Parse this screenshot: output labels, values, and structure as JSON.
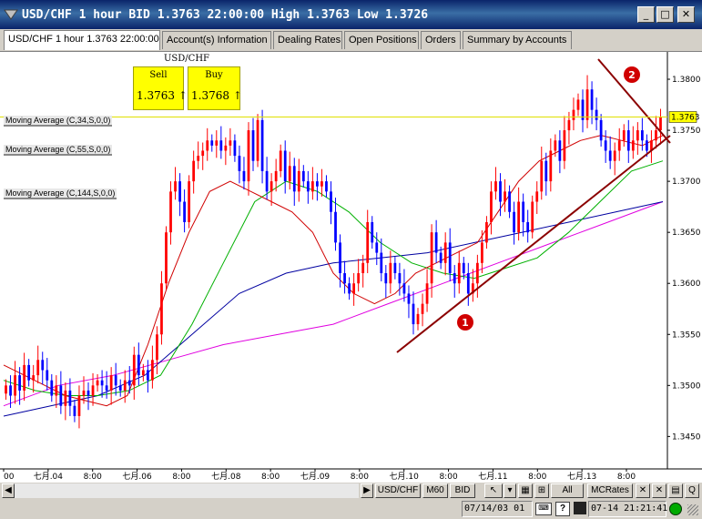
{
  "window": {
    "title": "USD/CHF 1 hour BID 1.3763 22:00:00 High 1.3763 Low 1.3726",
    "controls": [
      "_",
      "□",
      "✕"
    ]
  },
  "tabs": [
    {
      "label": "USD/CHF 1 hour 1.3763 22:00:00",
      "active": true
    },
    {
      "label": "Account(s) Information"
    },
    {
      "label": "Dealing Rates"
    },
    {
      "label": "Open Positions"
    },
    {
      "label": "Orders"
    },
    {
      "label": "Summary by Accounts"
    }
  ],
  "quote": {
    "symbol": "USD/CHF",
    "sell_label": "Sell",
    "buy_label": "Buy",
    "sell_value": "1.3763",
    "buy_value": "1.3768",
    "arrow": "↑"
  },
  "indicators": [
    "Moving Average (C,34,S,0,0)",
    "Moving Average (C,55,S,0,0)",
    "Moving Average (C,144,S,0,0)"
  ],
  "price_axis": {
    "ticks": [
      "1.3800",
      "1.3750",
      "1.3700",
      "1.3650",
      "1.3600",
      "1.3550",
      "1.3500",
      "1.3450"
    ],
    "current": "1.3763"
  },
  "time_axis": {
    "ticks": [
      "00",
      "七月.04",
      "8:00",
      "七月.06",
      "8:00",
      "七月.08",
      "8:00",
      "七月.09",
      "8:00",
      "七月.10",
      "8:00",
      "七月.11",
      "8:00",
      "七月.13",
      "8:00"
    ]
  },
  "annotations": {
    "label1": "❶",
    "label2": "❷"
  },
  "bottom_bar": {
    "play": "▶",
    "symbol": "USD/CHF",
    "period": "M60",
    "price_type": "BID",
    "all": "All",
    "mcrates": "MCRates",
    "q": "Q"
  },
  "status": {
    "left": "07/14/03 01",
    "right": "07-14 21:21:41"
  },
  "colors": {
    "bull_candle": "#ff0000",
    "bear_candle": "#0000ff",
    "ma34": "#d00000",
    "ma55": "#00b000",
    "ma144": "#0000a0",
    "ma_magenta": "#e000e0",
    "trendline": "#8b0000",
    "quote_box": "#ffff00"
  },
  "chart_data": {
    "type": "candlestick",
    "ylim": [
      1.342,
      1.3825
    ],
    "x_range": [
      0,
      145
    ],
    "closes": [
      1.35,
      1.349,
      1.351,
      1.3495,
      1.352,
      1.3505,
      1.351,
      1.3525,
      1.3515,
      1.3505,
      1.349,
      1.35,
      1.348,
      1.3495,
      1.348,
      1.347,
      1.349,
      1.3495,
      1.349,
      1.35,
      1.3505,
      1.35,
      1.3495,
      1.351,
      1.35,
      1.3495,
      1.3505,
      1.35,
      1.353,
      1.351,
      1.3515,
      1.3505,
      1.3525,
      1.355,
      1.36,
      1.365,
      1.369,
      1.37,
      1.368,
      1.366,
      1.37,
      1.372,
      1.3725,
      1.373,
      1.374,
      1.3735,
      1.374,
      1.373,
      1.3735,
      1.374,
      1.3725,
      1.371,
      1.37,
      1.375,
      1.372,
      1.376,
      1.371,
      1.369,
      1.37,
      1.371,
      1.373,
      1.37,
      1.3715,
      1.369,
      1.371,
      1.37,
      1.369,
      1.37,
      1.3695,
      1.37,
      1.369,
      1.367,
      1.364,
      1.361,
      1.36,
      1.359,
      1.36,
      1.361,
      1.362,
      1.366,
      1.364,
      1.363,
      1.361,
      1.36,
      1.362,
      1.361,
      1.36,
      1.359,
      1.358,
      1.356,
      1.357,
      1.358,
      1.36,
      1.365,
      1.363,
      1.362,
      1.364,
      1.361,
      1.36,
      1.362,
      1.361,
      1.359,
      1.36,
      1.362,
      1.364,
      1.366,
      1.369,
      1.37,
      1.368,
      1.369,
      1.367,
      1.365,
      1.368,
      1.366,
      1.365,
      1.368,
      1.369,
      1.372,
      1.37,
      1.373,
      1.374,
      1.372,
      1.375,
      1.376,
      1.377,
      1.378,
      1.376,
      1.379,
      1.377,
      1.376,
      1.374,
      1.373,
      1.372,
      1.373,
      1.374,
      1.375,
      1.373,
      1.374,
      1.375,
      1.374,
      1.373,
      1.374,
      1.375,
      1.3763
    ],
    "ma34": [
      1.352,
      1.351,
      1.35,
      1.349,
      1.3485,
      1.348,
      1.349,
      1.354,
      1.36,
      1.365,
      1.369,
      1.37,
      1.369,
      1.368,
      1.367,
      1.365,
      1.361,
      1.359,
      1.358,
      1.359,
      1.361,
      1.362,
      1.363,
      1.364,
      1.367,
      1.37,
      1.372,
      1.373,
      1.374,
      1.3745,
      1.374,
      1.3735,
      1.3745
    ],
    "ma55": [
      1.3505,
      1.3495,
      1.349,
      1.349,
      1.3495,
      1.351,
      1.356,
      1.362,
      1.368,
      1.37,
      1.369,
      1.367,
      1.364,
      1.362,
      1.361,
      1.3605,
      1.3615,
      1.3625,
      1.365,
      1.368,
      1.371,
      1.372
    ],
    "ma144": [
      1.347,
      1.348,
      1.349,
      1.351,
      1.355,
      1.359,
      1.361,
      1.362,
      1.3625,
      1.363,
      1.364,
      1.365,
      1.366,
      1.367,
      1.368
    ],
    "ma_magenta": [
      1.348,
      1.35,
      1.351,
      1.3525,
      1.354,
      1.355,
      1.356,
      1.358,
      1.36,
      1.362,
      1.364,
      1.366,
      1.368
    ]
  }
}
